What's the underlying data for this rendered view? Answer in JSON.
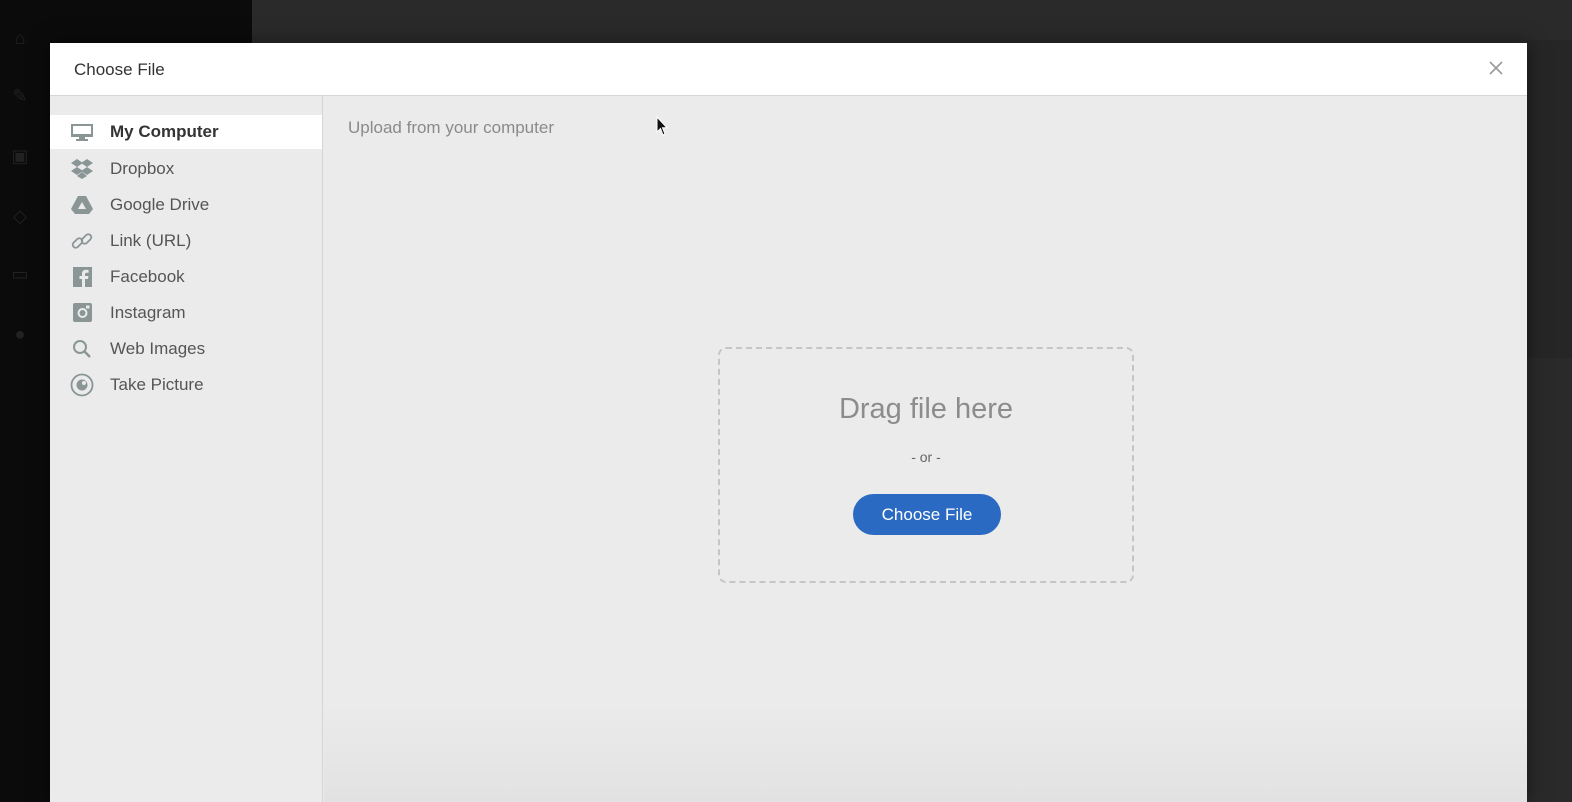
{
  "background_app": {
    "nav_icons": [
      "home-icon",
      "edit-icon",
      "image-icon",
      "plugin-icon",
      "folder-icon",
      "chat-icon"
    ]
  },
  "modal": {
    "title": "Choose File",
    "close_icon": "close-icon"
  },
  "sources": [
    {
      "label": "My Computer",
      "icon": "monitor-icon",
      "active": true
    },
    {
      "label": "Dropbox",
      "icon": "dropbox-icon",
      "active": false
    },
    {
      "label": "Google Drive",
      "icon": "google-drive-icon",
      "active": false
    },
    {
      "label": "Link (URL)",
      "icon": "link-icon",
      "active": false
    },
    {
      "label": "Facebook",
      "icon": "facebook-icon",
      "active": false
    },
    {
      "label": "Instagram",
      "icon": "instagram-icon",
      "active": false
    },
    {
      "label": "Web Images",
      "icon": "search-icon",
      "active": false
    },
    {
      "label": "Take Picture",
      "icon": "camera-icon",
      "active": false
    }
  ],
  "upload": {
    "title": "Upload from your computer",
    "drag_text": "Drag file here",
    "or_text": "- or -",
    "button_label": "Choose File"
  },
  "colors": {
    "accent": "#2a6ac3",
    "icon_gray": "#8a9596",
    "modal_bg": "#ebebeb"
  }
}
